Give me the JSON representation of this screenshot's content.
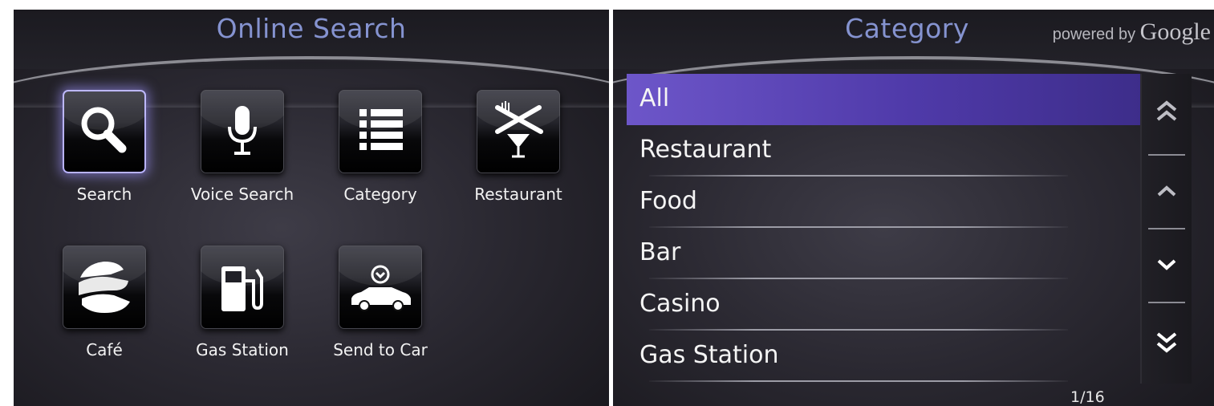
{
  "left_panel": {
    "title": "Online Search",
    "tiles": [
      {
        "label": "Search",
        "icon": "search-icon",
        "selected": true
      },
      {
        "label": "Voice Search",
        "icon": "microphone-icon"
      },
      {
        "label": "Category",
        "icon": "list-icon"
      },
      {
        "label": "Restaurant",
        "icon": "fork-knife-glass-icon"
      },
      {
        "label": "Café",
        "icon": "croissant-icon"
      },
      {
        "label": "Gas Station",
        "icon": "gas-pump-icon"
      },
      {
        "label": "Send to Car",
        "icon": "car-download-icon"
      }
    ]
  },
  "right_panel": {
    "title": "Category",
    "powered_by": "powered by",
    "brand": "Google",
    "items": [
      {
        "label": "All",
        "selected": true
      },
      {
        "label": "Restaurant"
      },
      {
        "label": "Food"
      },
      {
        "label": "Bar"
      },
      {
        "label": "Casino"
      },
      {
        "label": "Gas Station"
      }
    ],
    "scroll_buttons": [
      "page-up-icon",
      "up-icon",
      "down-icon",
      "page-down-icon"
    ],
    "page_indicator": "1/16"
  },
  "colors": {
    "title": "#8593d0",
    "selection": "#5a44b8",
    "tile_glow": "#b9b3ff"
  }
}
